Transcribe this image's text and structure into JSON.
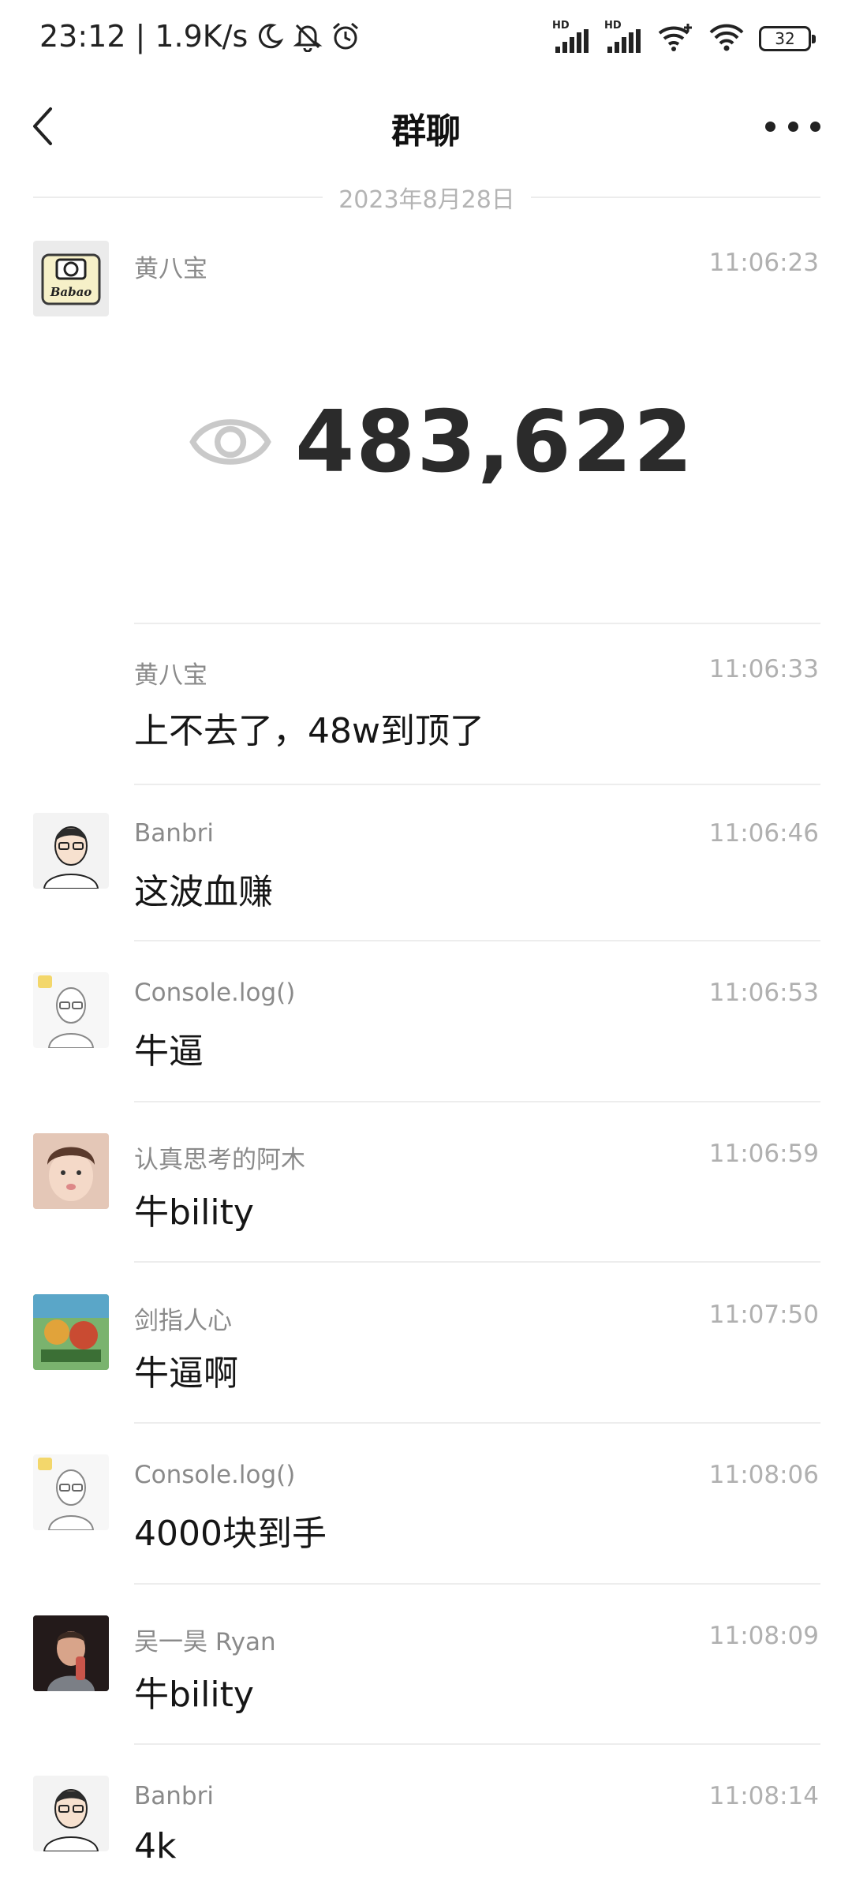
{
  "status_bar": {
    "time": "23:12",
    "separator": "|",
    "speed": "1.9K/s",
    "icons": [
      "moon-icon",
      "mute-icon",
      "alarm-icon"
    ],
    "signal_label": "HD",
    "battery": "32"
  },
  "nav": {
    "title": "群聊",
    "back_icon": "chevron-left-icon",
    "more_icon": "more-dots-icon"
  },
  "date_divider": "2023年8月28日",
  "image_message": {
    "view_count": "483,622",
    "icon": "eye-icon"
  },
  "messages": [
    {
      "sender": "黄八宝",
      "time": "11:06:23",
      "avatar_text": "Babao"
    },
    {
      "sender": "黄八宝",
      "time": "11:06:33",
      "text": "上不去了，48w到顶了"
    },
    {
      "sender": "Banbri",
      "time": "11:06:46",
      "text": "这波血赚"
    },
    {
      "sender": "Console.log()",
      "time": "11:06:53",
      "text": "牛逼"
    },
    {
      "sender": "认真思考的阿木",
      "time": "11:06:59",
      "text": "牛bility"
    },
    {
      "sender": "剑指人心",
      "time": "11:07:50",
      "text": "牛逼啊"
    },
    {
      "sender": "Console.log()",
      "time": "11:08:06",
      "text": "4000块到手"
    },
    {
      "sender": "吴一昊 Ryan",
      "time": "11:08:09",
      "text": "牛bility"
    },
    {
      "sender": "Banbri",
      "time": "11:08:14",
      "text": "4k"
    }
  ]
}
